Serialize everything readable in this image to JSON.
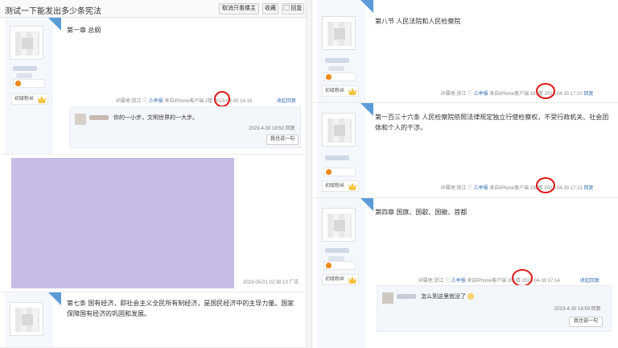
{
  "left": {
    "header": {
      "title": "测试一下能发出多少条宪法",
      "buttons": [
        "取消只看楼主",
        "收藏",
        "回复"
      ]
    },
    "post1": {
      "content": "第一章    总纲",
      "location": "IP属地:浙江",
      "report": "举报",
      "source": "来自iPhone客户端",
      "floor": "2楼",
      "time": "2023-04-30 14:15",
      "collapse": "收起回复",
      "reply": {
        "text": "你的一小步，文明世界的一大步。",
        "time": "2023-4-30 19:50",
        "reply_link": "回复",
        "say_button": "我也说一句"
      },
      "level_label": "初级粉丝"
    },
    "ad": {
      "time": "2023-05-01 02:38:13",
      "label": "广告"
    },
    "post2": {
      "content": "第七条    国有经济，即社会主义全民所有制经济，是国民经济中的主导力量。国家保障国有经济的巩固和发展。"
    }
  },
  "right": {
    "post1": {
      "content": "第八节    人民法院和人民检察院",
      "location": "IP属地:浙江",
      "report": "举报",
      "source": "来自iPhone客户端",
      "floor": "187楼",
      "time": "2023-04-30 17:10",
      "reply_link": "回复",
      "level_label": "初级粉丝"
    },
    "post2": {
      "content": "第一百三十六条    人民检察院依照法律规定独立行使检察权，不受行政机关、社会团体和个人的干涉。",
      "location": "IP属地:浙江",
      "report": "举报",
      "source": "来自iPhone客户端",
      "floor": "198楼",
      "time": "2023-04-30 17:13",
      "reply_link": "回复",
      "level_label": "初级粉丝"
    },
    "post3": {
      "content": "第四章    国旗、国歌、国徽、首都",
      "location": "IP属地:浙江",
      "report": "举报",
      "source": "来自iPhone客户端",
      "floor": "201楼",
      "time": "2023-04-30 17:14",
      "collapse": "收起回复",
      "level_label": "初级粉丝",
      "reply": {
        "text": "怎么到这里就没了",
        "time": "2023-4-30 18:59",
        "reply_link": "回复",
        "say_button": "我也说一句"
      }
    }
  },
  "colors": {
    "accent_blue": "#3a6fb5",
    "annotation_red": "#e01818",
    "ad_purple": "#c7bce6"
  },
  "icons": {
    "report": "warning-triangle-icon",
    "crown": "crown-icon",
    "fire": "fire-icon",
    "reply": "speech-bubble-icon"
  }
}
